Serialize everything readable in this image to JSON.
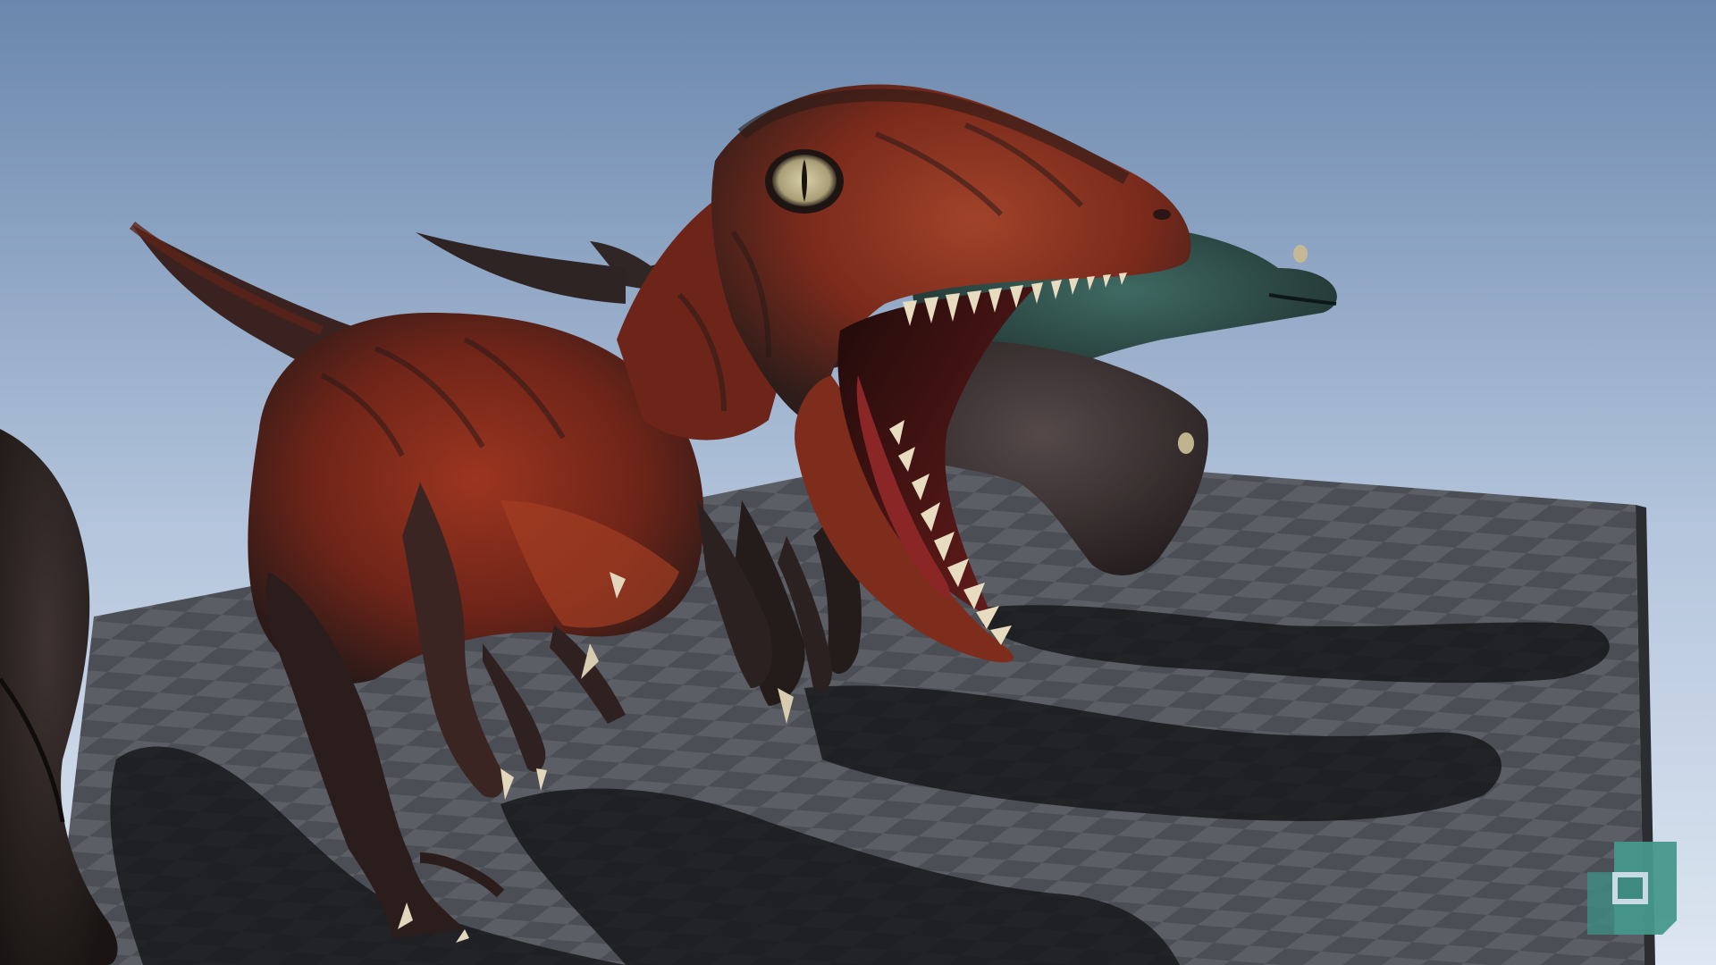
{
  "scene": {
    "description_colors": {
      "sky_top": "#6a87ad",
      "sky_bottom": "#d7e1ee",
      "floor_dark": "#3c3f45",
      "floor_light": "#55585e",
      "floor_edge": "#2b2d31",
      "shadow": "#15171a",
      "raptor_red": "#8a2c1c",
      "raptor_dark": "#2a1d1b",
      "raptor_belly": "#a23d22",
      "raptor_green": "#2d4a45",
      "raptor_gray": "#3a3331",
      "teeth": "#e8dcc0",
      "eye": "#c9bf9a",
      "mouth": "#4a1212"
    },
    "objects": [
      {
        "name": "red-raptor",
        "color": "raptor_red"
      },
      {
        "name": "green-raptor",
        "color": "raptor_green"
      },
      {
        "name": "dark-raptor",
        "color": "raptor_gray"
      },
      {
        "name": "left-raptor-partial",
        "color": "raptor_dark"
      }
    ]
  },
  "logo": {
    "icon": "engine-logo-icon",
    "color": "#3f8a7f"
  }
}
